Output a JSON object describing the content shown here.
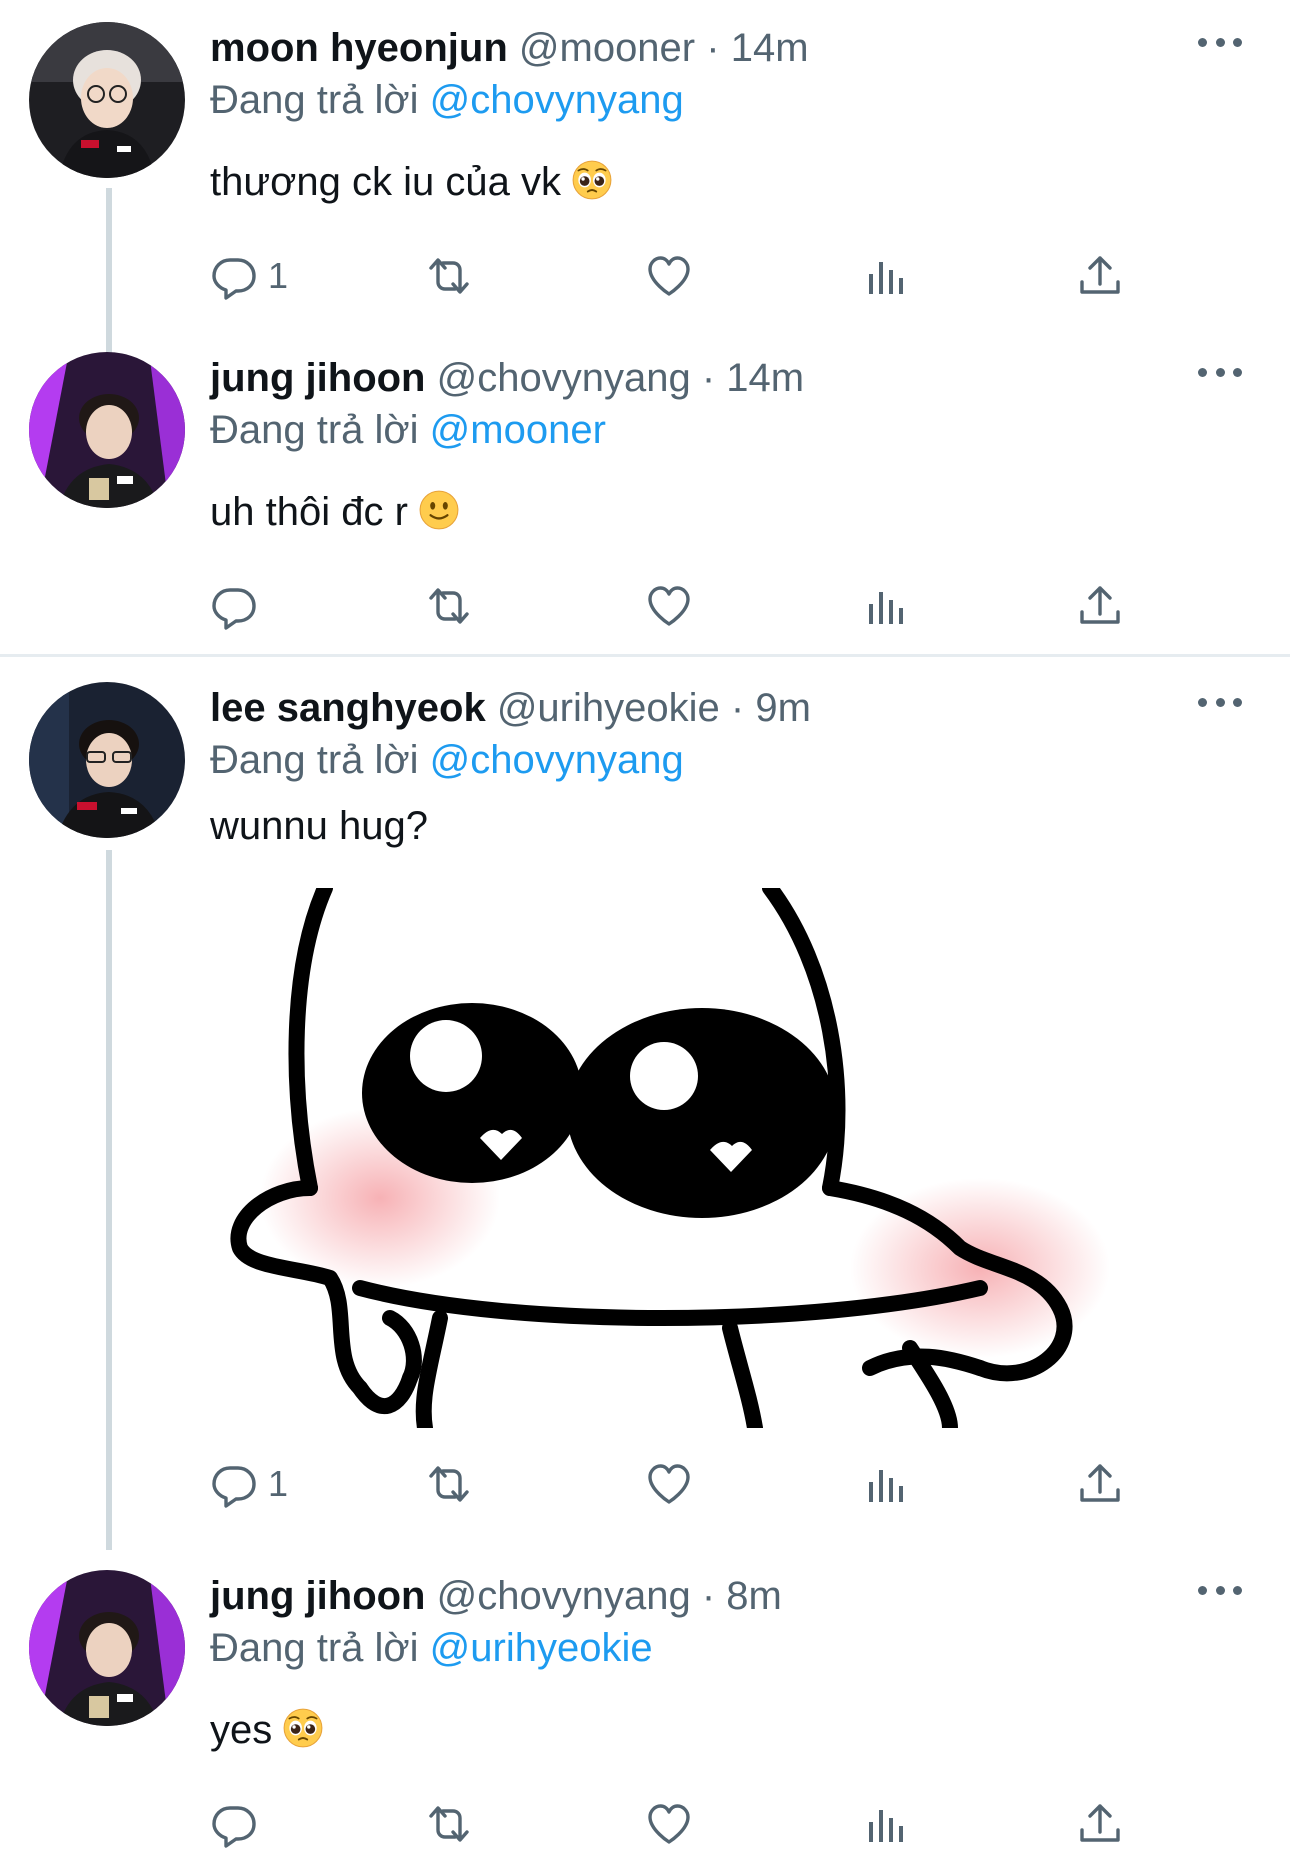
{
  "tweets": [
    {
      "name": "moon hyeonjun",
      "handle": "@mooner",
      "time": "14m",
      "reply_prefix": "Đang trả lời",
      "reply_mention": "@chovynyang",
      "text": "thương ck iu của vk",
      "emoji": "pleading-face",
      "reply_count": "1"
    },
    {
      "name": "jung jihoon",
      "handle": "@chovynyang",
      "time": "14m",
      "reply_prefix": "Đang trả lời",
      "reply_mention": "@mooner",
      "text": "uh thôi đc r",
      "emoji": "slightly-smiling-face",
      "reply_count": ""
    },
    {
      "name": "lee sanghyeok",
      "handle": "@urihyeokie",
      "time": "9m",
      "reply_prefix": "Đang trả lời",
      "reply_mention": "@chovynyang",
      "text": "wunnu hug?",
      "media": "cartoon-hug-sticker",
      "reply_count": "1"
    },
    {
      "name": "jung jihoon",
      "handle": "@chovynyang",
      "time": "8m",
      "reply_prefix": "Đang trả lời",
      "reply_mention": "@urihyeokie",
      "text": "yes",
      "emoji": "pleading-face",
      "reply_count": ""
    }
  ],
  "separator": "·",
  "icons": {
    "reply": "reply-icon",
    "retweet": "retweet-icon",
    "like": "heart-icon",
    "analytics": "analytics-icon",
    "share": "share-icon",
    "more": "more-icon"
  },
  "colors": {
    "text": "#0f1419",
    "secondary": "#536471",
    "link": "#1d9bf0",
    "thread_line": "#cfd9de",
    "divider": "#e6ecf0"
  }
}
